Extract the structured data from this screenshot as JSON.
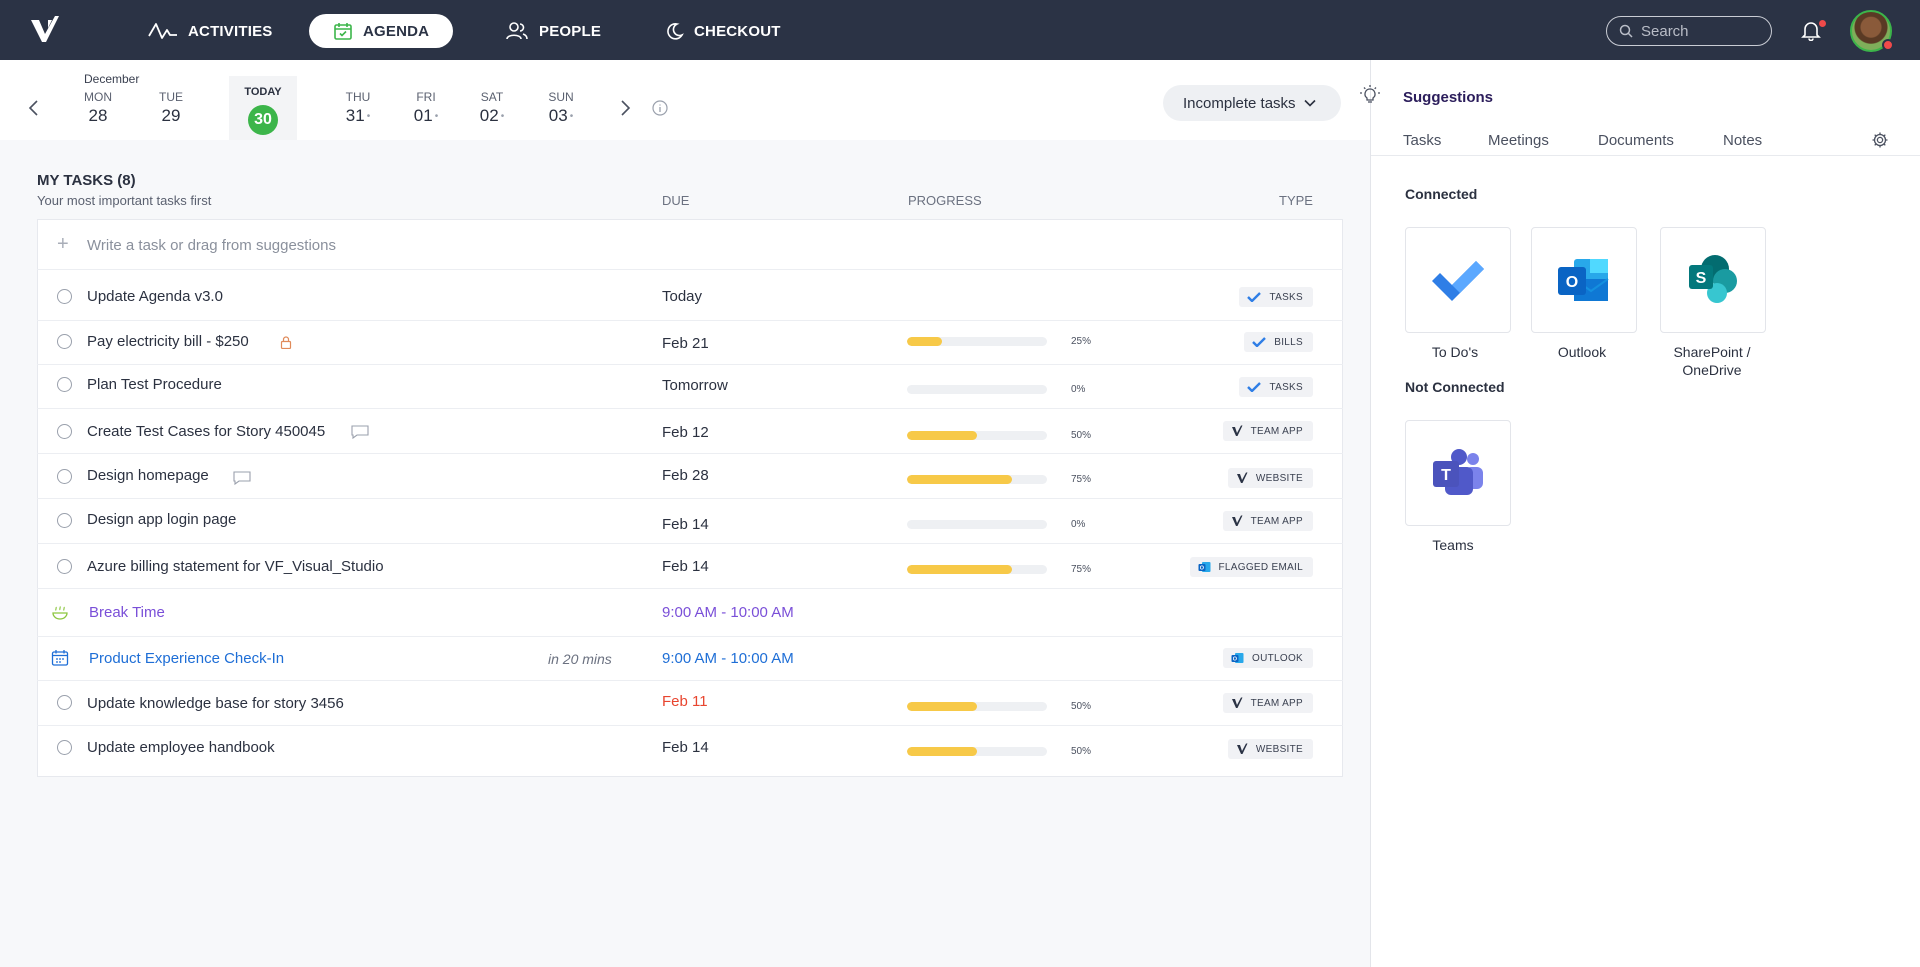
{
  "nav": {
    "items": [
      {
        "label": "ACTIVITIES",
        "icon": "activity-icon"
      },
      {
        "label": "AGENDA",
        "icon": "calendar-icon",
        "active": true
      },
      {
        "label": "PEOPLE",
        "icon": "people-icon"
      },
      {
        "label": "CHECKOUT",
        "icon": "moon-icon"
      }
    ],
    "search_placeholder": "Search"
  },
  "date_strip": {
    "month": "December",
    "days": [
      {
        "name": "MON",
        "num": "28",
        "dot": ""
      },
      {
        "name": "TUE",
        "num": "29",
        "dot": ""
      },
      {
        "name": "THU",
        "num": "31",
        "dot": "•"
      },
      {
        "name": "FRI",
        "num": "01",
        "dot": "•"
      },
      {
        "name": "SAT",
        "num": "02",
        "dot": "•"
      },
      {
        "name": "SUN",
        "num": "03",
        "dot": "•"
      }
    ],
    "today_label": "TODAY",
    "today_num": "30"
  },
  "filter_label": "Incomplete tasks",
  "tasks": {
    "title": "MY TASKS (8)",
    "subtitle": "Your most important tasks first",
    "col_due": "DUE",
    "col_progress": "PROGRESS",
    "col_type": "TYPE",
    "add_placeholder": "Write a task or drag from suggestions",
    "rows": [
      {
        "title": "Update Agenda v3.0",
        "due": "Today",
        "progress": null,
        "pct": "",
        "type": "TASKS",
        "type_icon": "todo-check-icon"
      },
      {
        "title": "Pay electricity bill - $250",
        "due": "Feb 21",
        "progress": 0.25,
        "pct": "25%",
        "type": "BILLS",
        "type_icon": "todo-check-icon"
      },
      {
        "title": "Plan Test Procedure",
        "due": "Tomorrow",
        "progress": 0,
        "pct": "0%",
        "type": "TASKS",
        "type_icon": "todo-check-icon"
      },
      {
        "title": "Create Test Cases for Story 450045",
        "due": "Feb 12",
        "progress": 0.5,
        "pct": "50%",
        "type": "TEAM APP",
        "type_icon": "v-logo-icon"
      },
      {
        "title": "Design homepage",
        "due": "Feb 28",
        "progress": 0.75,
        "pct": "75%",
        "type": "WEBSITE",
        "type_icon": "v-logo-icon"
      },
      {
        "title": "Design app login page",
        "due": "Feb 14",
        "progress": 0,
        "pct": "0%",
        "type": "TEAM APP",
        "type_icon": "v-logo-icon"
      },
      {
        "title": "Azure billing statement for VF_Visual_Studio",
        "due": "Feb 14",
        "progress": 0.75,
        "pct": "75%",
        "type": "FLAGGED EMAIL",
        "type_icon": "outlook-icon"
      },
      {
        "title": "Break Time",
        "due": "9:00 AM - 10:00 AM",
        "type": ""
      },
      {
        "title": "Product Experience Check-In",
        "in_time": "in 20 mins",
        "due": "9:00 AM - 10:00 AM",
        "type": "OUTLOOK",
        "type_icon": "outlook-icon"
      },
      {
        "title": "Update knowledge base for story 3456",
        "due": "Feb 11",
        "progress": 0.5,
        "pct": "50%",
        "type": "TEAM APP",
        "type_icon": "v-logo-icon"
      },
      {
        "title": "Update employee handbook",
        "due": "Feb 14",
        "progress": 0.5,
        "pct": "50%",
        "type": "WEBSITE",
        "type_icon": "v-logo-icon"
      }
    ]
  },
  "suggestions": {
    "title": "Suggestions",
    "tabs": [
      "Tasks",
      "Meetings",
      "Documents",
      "Notes"
    ],
    "connected_label": "Connected",
    "not_connected_label": "Not Connected",
    "connected_apps": [
      "To Do's",
      "Outlook",
      "SharePoint / OneDrive"
    ],
    "not_connected_apps": [
      "Teams"
    ]
  },
  "colors": {
    "topbar": "#2b3345",
    "accent_green": "#3cb54a",
    "progress_fill": "#f7c948",
    "overdue_red": "#e8452f",
    "break_purple": "#7a4fd8",
    "meeting_blue": "#1e6ed6"
  }
}
